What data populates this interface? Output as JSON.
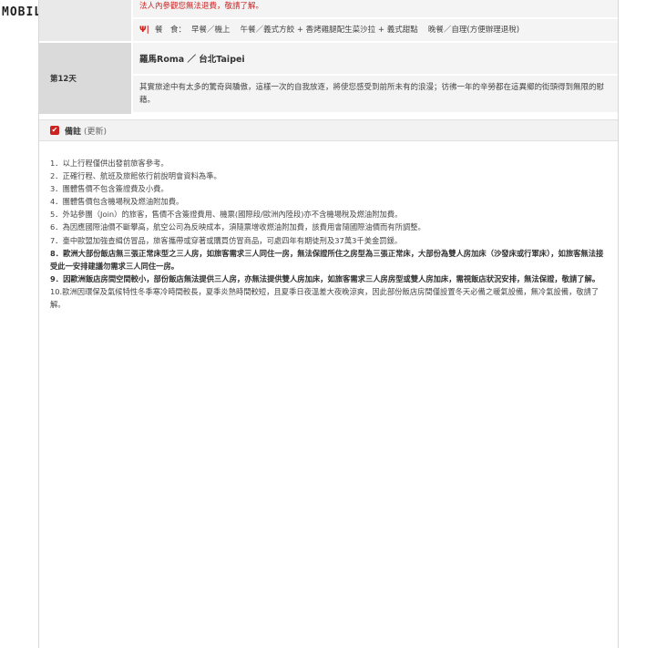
{
  "watermark": {
    "text": "MOBILE",
    "icon": "mobile01-logo-icon"
  },
  "itinerary": {
    "warning": "法人內參觀您無法退費，敬請了解。",
    "meals": {
      "label": "餐　食：",
      "text": "早餐／機上　 午餐／義式方餃 + 香烤雞腿配生菜沙拉 + 義式甜點　 晚餐／自理(方便辦理退稅)"
    },
    "day": {
      "label": "第12天",
      "city": "羅馬Roma ／ 台北Taipei",
      "description": "其實旅途中有太多的驚奇與驕傲，這樣一次的自我放逐，將使您感受到前所未有的浪漫；彷彿一年的辛勞都在這異鄉的街頭得到無限的慰藉。"
    }
  },
  "notes": {
    "title": "備註",
    "update": "(更新)",
    "items": [
      {
        "text": "1．以上行程僅供出發前旅客參考。",
        "bold": false
      },
      {
        "text": "2．正確行程、航班及旅館依行前說明會資料為準。",
        "bold": false
      },
      {
        "text": "3．團體售價不包含簽證費及小費。",
        "bold": false
      },
      {
        "text": "4．團體售價包含機場稅及燃油附加費。",
        "bold": false
      },
      {
        "text": "5．外站參團（Join）的旅客，售價不含簽證費用、機票(國際段/歐洲內陸段)亦不含機場稅及燃油附加費。",
        "bold": false
      },
      {
        "text": "6．為因應國際油價不斷攀高，航空公司為反映成本，須隨票增收燃油附加費，該費用會隨國際油價而有所調整。",
        "bold": false
      },
      {
        "text": "7．臺中歐盟加強查緝仿冒品，旅客攜帶或穿著或購買仿冒商品，可處四年有期徒刑及37萬3千美金罰鍰。",
        "bold": false
      },
      {
        "text": "8．歐洲大部份飯店無三張正常床型之三人房，如旅客需求三人同住一房，無法保證所住之房型為三張正常床，大部份為雙人房加床（沙發床或行軍床），如旅客無法接受此一安排建議勿需求三人同住一房。",
        "bold": true
      },
      {
        "text": "9．因歐洲飯店房間空間較小，部份飯店無法提供三人房，亦無法提供雙人房加床，如旅客需求三人房房型或雙人房加床，需視飯店狀況安排，無法保證，敬請了解。",
        "bold": true
      },
      {
        "text": "10.歐洲因環保及氣候特性冬季寒冷時間較長，夏季炎熱時間較短，且夏季日夜溫差大夜晚涼爽，因此部份飯店房間僅設置冬天必備之暖氣設備，無冷氣設備，敬請了解。",
        "bold": false
      }
    ]
  }
}
